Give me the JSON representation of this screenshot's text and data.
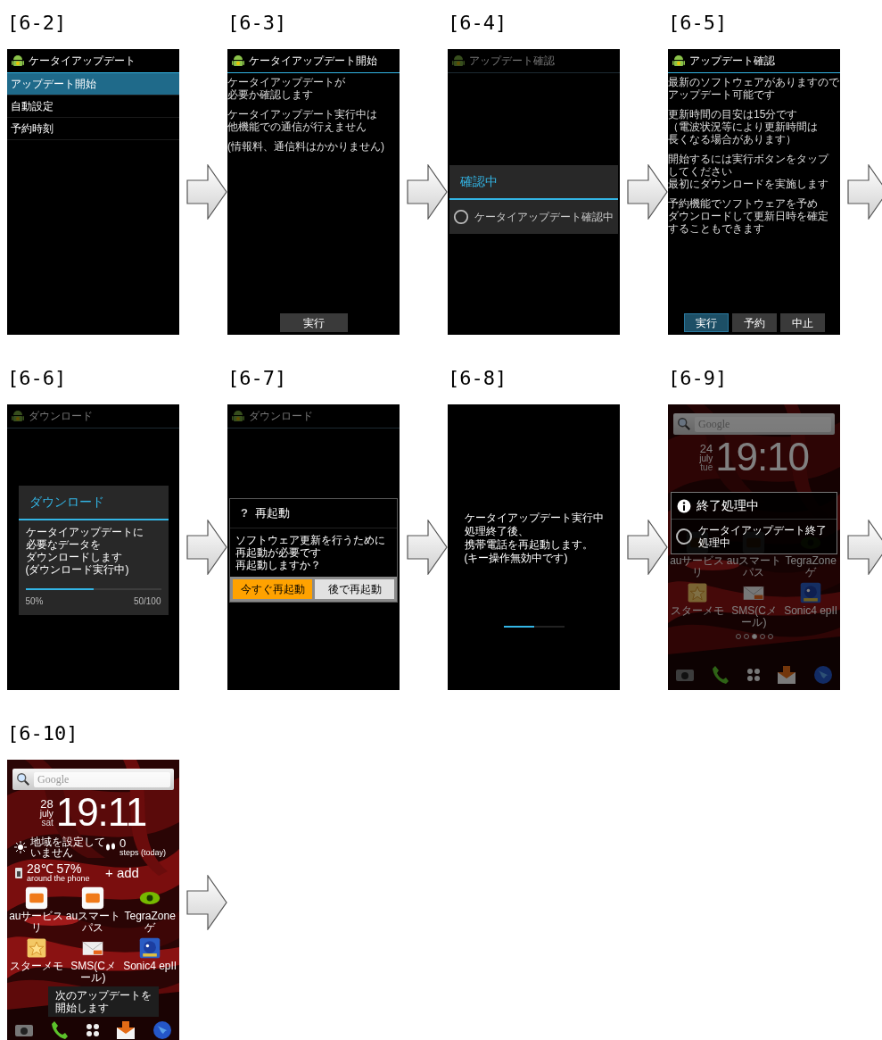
{
  "steps": [
    {
      "label": "[6-2]",
      "arrow": true,
      "screen": {
        "kind": "menu",
        "header": {
          "title": "ケータイアップデート",
          "dimmed": false
        },
        "items": [
          {
            "label": "アップデート開始",
            "selected": true
          },
          {
            "label": "自動設定",
            "selected": false
          },
          {
            "label": "予約時刻",
            "selected": false
          }
        ]
      }
    },
    {
      "label": "[6-3]",
      "arrow": true,
      "screen": {
        "kind": "notice",
        "header": {
          "title": "ケータイアップデート開始",
          "dimmed": false
        },
        "paragraphs": [
          [
            "ケータイアップデートが",
            "必要か確認します"
          ],
          [
            "ケータイアップデート実行中は",
            "他機能での通信が行えません"
          ],
          [
            "(情報料、通信料はかかりません)"
          ]
        ],
        "buttons": [
          {
            "label": "実行",
            "selected": false
          }
        ]
      }
    },
    {
      "label": "[6-4]",
      "arrow": true,
      "screen": {
        "kind": "progress",
        "header": {
          "title": "アップデート確認",
          "dimmed": true
        },
        "dialog": {
          "title": "確認中",
          "message": "ケータイアップデート確認中"
        }
      }
    },
    {
      "label": "[6-5]",
      "arrow": true,
      "screen": {
        "kind": "notice",
        "header": {
          "title": "アップデート確認",
          "dimmed": false
        },
        "paragraphs": [
          [
            "最新のソフトウェアがありますので",
            "アップデート可能です"
          ],
          [
            "更新時間の目安は15分です",
            "（電波状況等により更新時間は",
            "長くなる場合があります）"
          ],
          [
            "開始するには実行ボタンをタップ",
            "してください",
            "最初にダウンロードを実施します"
          ],
          [
            "予約機能でソフトウェアを予め",
            "ダウンロードして更新日時を確定",
            "することもできます"
          ]
        ],
        "buttons": [
          {
            "label": "実行",
            "selected": true
          },
          {
            "label": "予約",
            "selected": false
          },
          {
            "label": "中止",
            "selected": false
          }
        ]
      }
    },
    {
      "label": "[6-6]",
      "arrow": true,
      "screen": {
        "kind": "download",
        "header": {
          "title": "ダウンロード",
          "dimmed": true
        },
        "dialog": {
          "title": "ダウンロード",
          "lines": [
            "ケータイアップデートに",
            "必要なデータを",
            "ダウンロードします",
            "(ダウンロード実行中)"
          ],
          "level": 0.5,
          "percent": "50%",
          "count": "50/100"
        }
      }
    },
    {
      "label": "[6-7]",
      "arrow": true,
      "screen": {
        "kind": "confirm",
        "header": {
          "title": "ダウンロード",
          "dimmed": true
        },
        "dialog": {
          "icon": "?",
          "title": "再起動",
          "lines": [
            "ソフトウェア更新を行うために",
            "再起動が必要です",
            "再起動しますか？"
          ],
          "buttons": [
            {
              "label": "今すぐ再起動",
              "kind": "primary"
            },
            {
              "label": "後で再起動",
              "kind": "secondary"
            }
          ]
        }
      }
    },
    {
      "label": "[6-8]",
      "arrow": true,
      "screen": {
        "kind": "boot",
        "lines": [
          "ケータイアップデート実行中",
          "処理終了後、",
          "携帯電話を再起動します。",
          "(キー操作無効中です)"
        ],
        "level": 0.5
      }
    },
    {
      "label": "[6-9]",
      "arrow": true,
      "screen": {
        "kind": "home",
        "dimmed": true,
        "search": {
          "placeholder": "Google"
        },
        "clock": {
          "day": "24",
          "month": "july",
          "weekday": "tue",
          "time": "19:10"
        },
        "app_rows": [
          [
            {
              "label": "auサービスリ"
            },
            {
              "label": "auスマートパス"
            },
            {
              "label": "TegraZone ゲ"
            }
          ],
          [
            {
              "label": "スターメモ"
            },
            {
              "label": "SMS(Cメール)"
            },
            {
              "label": "Sonic4 epII"
            }
          ]
        ],
        "page_dots": [
          {
            "selected": false
          },
          {
            "selected": false
          },
          {
            "selected": true
          },
          {
            "selected": false
          },
          {
            "selected": false
          }
        ],
        "dialog": {
          "title": "終了処理中",
          "message": "ケータイアップデート終了処理中"
        }
      }
    },
    {
      "label": "[6-10]",
      "arrow": true,
      "screen": {
        "kind": "home",
        "dimmed": false,
        "search": {
          "placeholder": "Google"
        },
        "clock": {
          "day": "28",
          "month": "july",
          "weekday": "sat",
          "time": "19:11"
        },
        "widgets": {
          "weather": [
            "地域を設定して",
            "いません"
          ],
          "steps": "0",
          "steps_caption": "steps (today)",
          "temperature": "28℃ 57%",
          "temperature_caption": "around the phone",
          "add": "+ add"
        },
        "app_rows": [
          [
            {
              "label": "auサービスリ"
            },
            {
              "label": "auスマートパス"
            },
            {
              "label": "TegraZone ゲ"
            }
          ],
          [
            {
              "label": "スターメモ"
            },
            {
              "label": "SMS(Cメール)"
            },
            {
              "label": "Sonic4 epII"
            }
          ]
        ],
        "toast": [
          "次のアップデートを",
          "開始します"
        ]
      }
    }
  ]
}
